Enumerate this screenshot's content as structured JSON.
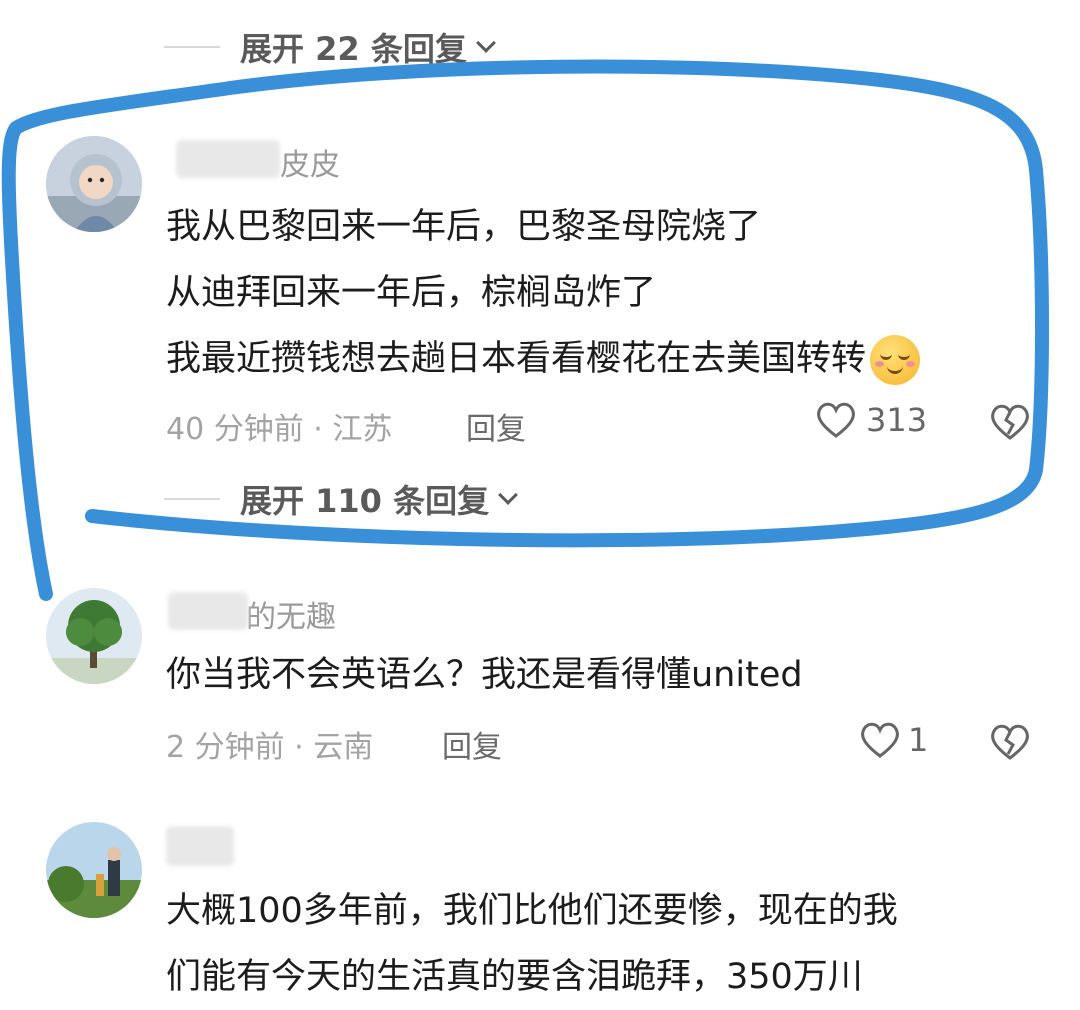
{
  "top_expand": {
    "label": "展开 22 条回复"
  },
  "comments": [
    {
      "username_visible": "皮皮",
      "lines": [
        "我从巴黎回来一年后，巴黎圣母院烧了",
        "从迪拜回来一年后，棕榈岛炸了",
        "我最近攒钱想去趟日本看看樱花在去美国转转"
      ],
      "emoji": "smiling-blush-emoji",
      "time": "40 分钟前 · 江苏",
      "reply": "回复",
      "likes": "313",
      "expand": "展开 110 条回复"
    },
    {
      "username_visible": "的无趣",
      "lines": [
        "你当我不会英语么？我还是看得懂united"
      ],
      "time": "2 分钟前 · 云南",
      "reply": "回复",
      "likes": "1"
    },
    {
      "lines": [
        "大概100多年前，我们比他们还要惨，现在的我",
        "们能有今天的生活真的要含泪跪拜，350万川"
      ]
    }
  ],
  "colors": {
    "annotation": "#3a8fd9",
    "meta": "#a3a3a3"
  }
}
